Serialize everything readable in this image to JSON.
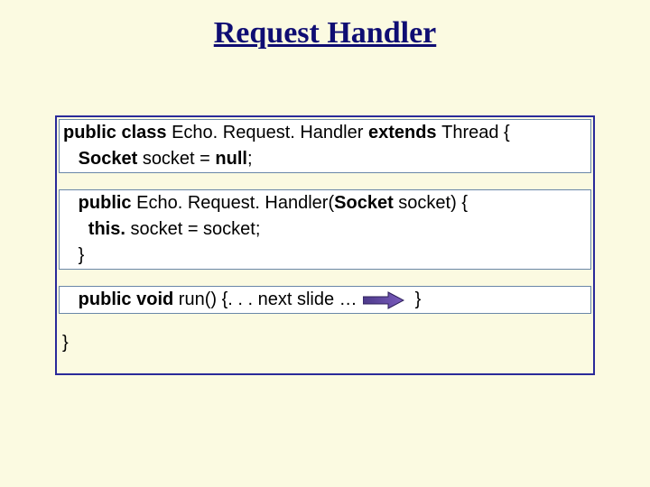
{
  "slide": {
    "title": "Request Handler"
  },
  "code": {
    "block1": {
      "line1_kw1": "public class ",
      "line1_txt1": "Echo. Request. Handler ",
      "line1_kw2": "extends ",
      "line1_txt2": "Thread {",
      "line2_kw1": "   Socket ",
      "line2_txt1": "socket = ",
      "line2_kw2": "null",
      "line2_txt2": ";"
    },
    "block2": {
      "line1_kw1": "   public ",
      "line1_txt1": "Echo. Request. Handler(",
      "line1_kw2": "Socket ",
      "line1_txt2": "socket) {",
      "line2_kw1": "     this. ",
      "line2_txt1": "socket = socket;",
      "line3_txt1": "   }"
    },
    "block3": {
      "line1_kw1": "   public void ",
      "line1_txt1": "run() {. . . next slide …",
      "line1_txt2": "}"
    },
    "free": {
      "closing": "}"
    }
  }
}
